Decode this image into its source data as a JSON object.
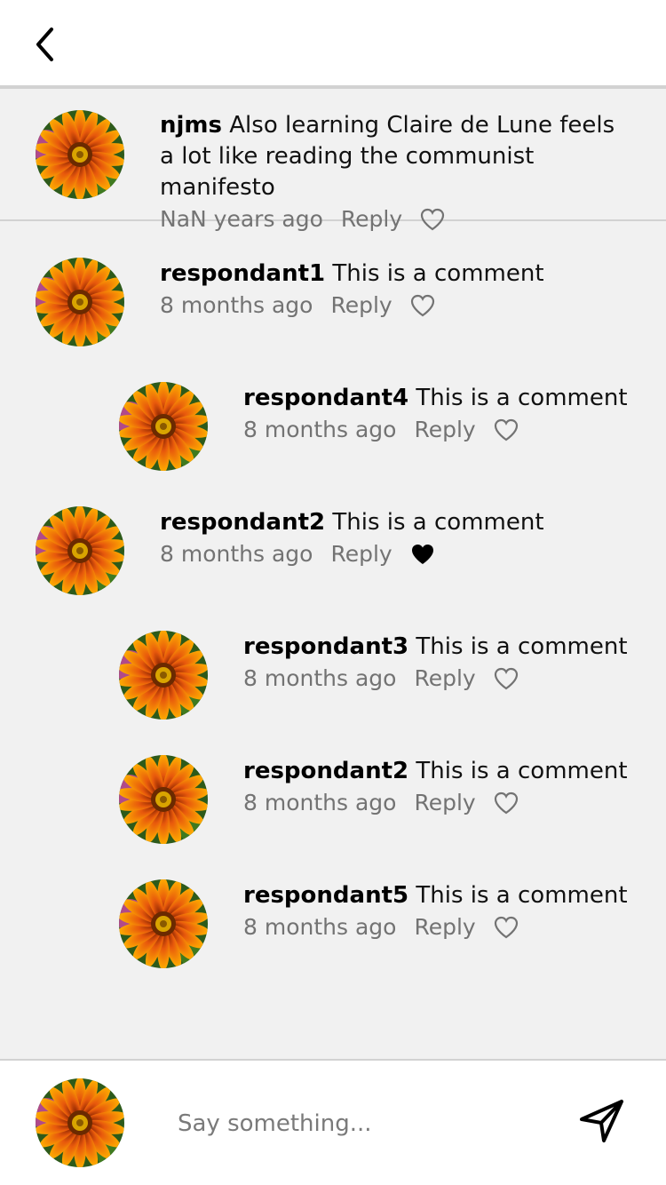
{
  "header": {
    "back_icon": "chevron-left-icon"
  },
  "caption": {
    "username": "njms",
    "text": "Also learning Claire de Lune feels a lot like reading the communist manifesto",
    "time": "NaN years ago",
    "reply_label": "Reply",
    "liked": false
  },
  "comments": [
    {
      "username": "respondant1",
      "text": "This is a comment",
      "time": "8 months ago",
      "reply_label": "Reply",
      "liked": false,
      "nested": false
    },
    {
      "username": "respondant4",
      "text": "This is a comment",
      "time": "8 months ago",
      "reply_label": "Reply",
      "liked": false,
      "nested": true
    },
    {
      "username": "respondant2",
      "text": "This is a comment",
      "time": "8 months ago",
      "reply_label": "Reply",
      "liked": true,
      "nested": false
    },
    {
      "username": "respondant3",
      "text": "This is a comment",
      "time": "8 months ago",
      "reply_label": "Reply",
      "liked": false,
      "nested": true
    },
    {
      "username": "respondant2",
      "text": "This is a comment",
      "time": "8 months ago",
      "reply_label": "Reply",
      "liked": false,
      "nested": true
    },
    {
      "username": "respondant5",
      "text": "This is a comment",
      "time": "8 months ago",
      "reply_label": "Reply",
      "liked": false,
      "nested": true
    }
  ],
  "footer": {
    "placeholder": "Say something...",
    "send_icon": "send-icon"
  },
  "colors": {
    "background": "#f1f1f1",
    "meta_text": "#737373",
    "divider": "#d2d2d2"
  }
}
